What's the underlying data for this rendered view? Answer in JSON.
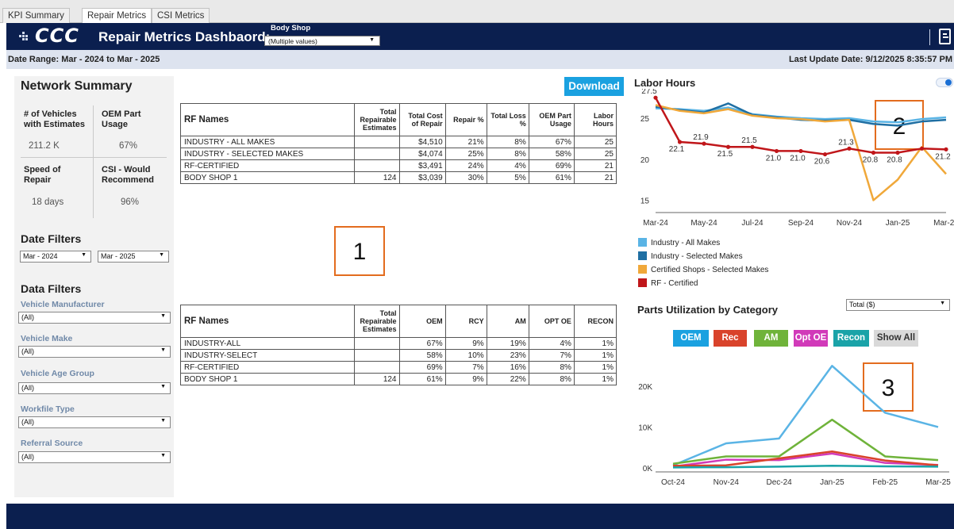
{
  "tabs": [
    "KPI Summary",
    "Repair Metrics",
    "CSI Metrics"
  ],
  "header": {
    "logo": "CCC",
    "title": "Repair Metrics Dashbaord:",
    "shop_label": "Body Shop",
    "shop_value": "(Multiple values)"
  },
  "date_bar": {
    "range": "Date Range: Mar - 2024 to Mar - 2025",
    "update": "Last Update Date: 9/12/2025 8:35:57 PM"
  },
  "network_summary": {
    "title": "Network Summary",
    "kpis": [
      {
        "label_1": "# of Vehicles",
        "label_2": "with Estimates",
        "value": "211.2 K"
      },
      {
        "label_1": "OEM Part",
        "label_2": "Usage",
        "value": "67%"
      },
      {
        "label_1": "Speed of",
        "label_2": "Repair",
        "value": "18 days"
      },
      {
        "label_1": "CSI - Would",
        "label_2": "Recommend",
        "value": "96%"
      }
    ]
  },
  "date_filters": {
    "title": "Date Filters",
    "from": "Mar - 2024",
    "to": "Mar - 2025"
  },
  "data_filters": {
    "title": "Data Filters",
    "items": [
      {
        "label": "Vehicle Manufacturer",
        "value": "(All)"
      },
      {
        "label": "Vehicle Make",
        "value": "(All)"
      },
      {
        "label": "Vehicle Age Group",
        "value": "(All)"
      },
      {
        "label": "Workfile Type",
        "value": "(All)"
      },
      {
        "label": "Referral Source",
        "value": "(All)"
      }
    ]
  },
  "download_label": "Download",
  "table1": {
    "headers": [
      "RF Names",
      "Total Repairable Estimates",
      "Total Cost of Repair",
      "Repair %",
      "Total Loss %",
      "OEM Part Usage",
      "Labor Hours"
    ],
    "rows": [
      [
        "INDUSTRY - ALL MAKES",
        "",
        "$4,510",
        "21%",
        "8%",
        "67%",
        "25"
      ],
      [
        "INDUSTRY - SELECTED MAKES",
        "",
        "$4,074",
        "25%",
        "8%",
        "58%",
        "25"
      ],
      [
        "RF-CERTIFIED",
        "",
        "$3,491",
        "24%",
        "4%",
        "69%",
        "21"
      ],
      [
        "BODY SHOP 1",
        "124",
        "$3,039",
        "30%",
        "5%",
        "61%",
        "21"
      ]
    ]
  },
  "table2": {
    "headers": [
      "RF Names",
      "Total Repairable Estimates",
      "OEM",
      "RCY",
      "AM",
      "OPT OE",
      "RECON"
    ],
    "rows": [
      [
        "INDUSTRY-ALL",
        "",
        "67%",
        "9%",
        "19%",
        "4%",
        "1%"
      ],
      [
        "INDUSTRY-SELECT",
        "",
        "58%",
        "10%",
        "23%",
        "7%",
        "1%"
      ],
      [
        "RF-CERTIFIED",
        "",
        "69%",
        "7%",
        "16%",
        "8%",
        "1%"
      ],
      [
        "BODY SHOP 1",
        "124",
        "61%",
        "9%",
        "22%",
        "8%",
        "1%"
      ]
    ]
  },
  "annotations": [
    "1",
    "2",
    "3"
  ],
  "labor_chart_title": "Labor Hours",
  "parts_chart_title": "Parts Utilization by Category",
  "parts_select": "Total ($)",
  "parts_buttons": [
    {
      "label": "OEM",
      "color": "#1aa1e0"
    },
    {
      "label": "Rec",
      "color": "#d9432b"
    },
    {
      "label": "AM",
      "color": "#6fb33a"
    },
    {
      "label": "Opt OE",
      "color": "#d13ab9"
    },
    {
      "label": "Recon",
      "color": "#1aa3a8"
    },
    {
      "label": "Show All",
      "color": "#d9d9d9"
    }
  ],
  "chart_data": [
    {
      "type": "line",
      "title": "Labor Hours",
      "x": [
        "Mar-24",
        "Apr-24",
        "May-24",
        "Jun-24",
        "Jul-24",
        "Aug-24",
        "Sep-24",
        "Oct-24",
        "Nov-24",
        "Dec-24",
        "Jan-25",
        "Feb-25",
        "Mar-25"
      ],
      "x_ticks": [
        "Mar-24",
        "May-24",
        "Jul-24",
        "Sep-24",
        "Nov-24",
        "Jan-25",
        "Mar-25"
      ],
      "y_ticks": [
        15,
        20,
        25
      ],
      "ylim": [
        13.5,
        28
      ],
      "series": [
        {
          "name": "Industry - All Makes",
          "color": "#5ab4e5",
          "values": [
            26.2,
            26.1,
            25.9,
            26.3,
            25.5,
            25.2,
            25.0,
            24.9,
            25.0,
            24.6,
            24.5,
            24.9,
            25.1
          ]
        },
        {
          "name": "Industry - Selected Makes",
          "color": "#1f6fa3",
          "values": [
            26.4,
            26.0,
            25.7,
            26.8,
            25.4,
            25.1,
            24.8,
            24.7,
            24.8,
            24.3,
            24.1,
            24.6,
            24.8
          ]
        },
        {
          "name": "Certified Shops - Selected Makes",
          "color": "#f0a83a",
          "values": [
            26.6,
            25.9,
            25.6,
            26.1,
            25.3,
            25.0,
            24.9,
            24.6,
            24.8,
            15.0,
            17.5,
            21.5,
            18.2
          ]
        },
        {
          "name": "RF - Certified",
          "color": "#c0161a",
          "values": [
            27.5,
            22.1,
            21.9,
            21.5,
            21.5,
            21.0,
            21.0,
            20.6,
            21.3,
            20.8,
            20.8,
            21.3,
            21.2
          ]
        }
      ],
      "data_labels": [
        {
          "series": "RF - Certified",
          "index": 0,
          "text": "27.5"
        },
        {
          "series": "RF - Certified",
          "index": 1,
          "text": "22.1"
        },
        {
          "series": "RF - Certified",
          "index": 2,
          "text": "21.9"
        },
        {
          "series": "RF - Certified",
          "index": 3,
          "text": "21.5"
        },
        {
          "series": "RF - Certified",
          "index": 4,
          "text": "21.5"
        },
        {
          "series": "RF - Certified",
          "index": 5,
          "text": "21.0"
        },
        {
          "series": "RF - Certified",
          "index": 6,
          "text": "21.0"
        },
        {
          "series": "RF - Certified",
          "index": 7,
          "text": "20.6"
        },
        {
          "series": "RF - Certified",
          "index": 8,
          "text": "21.3"
        },
        {
          "series": "RF - Certified",
          "index": 9,
          "text": "20.8"
        },
        {
          "series": "RF - Certified",
          "index": 10,
          "text": "20.8"
        },
        {
          "series": "RF - Certified",
          "index": 12,
          "text": "21.2"
        }
      ],
      "legend": "bottom"
    },
    {
      "type": "line",
      "title": "Parts Utilization by Category",
      "x": [
        "Oct-24",
        "Nov-24",
        "Dec-24",
        "Jan-25",
        "Feb-25",
        "Mar-25"
      ],
      "y_ticks": [
        0,
        10000,
        20000
      ],
      "y_tick_labels": [
        "0K",
        "10K",
        "20K"
      ],
      "ylim": [
        -1000,
        27000
      ],
      "series": [
        {
          "name": "OEM",
          "color": "#5ab4e5",
          "values": [
            600,
            6000,
            7200,
            25000,
            13500,
            10000
          ]
        },
        {
          "name": "AM",
          "color": "#6fb33a",
          "values": [
            1000,
            2800,
            2800,
            11800,
            2800,
            1900
          ]
        },
        {
          "name": "Opt OE",
          "color": "#d13ab9",
          "values": [
            300,
            2000,
            1900,
            3500,
            1200,
            700
          ]
        },
        {
          "name": "Rec",
          "color": "#d9432b",
          "values": [
            500,
            600,
            2300,
            4000,
            1800,
            600
          ]
        },
        {
          "name": "Recon",
          "color": "#1aa3a8",
          "values": [
            100,
            150,
            300,
            500,
            350,
            300
          ]
        }
      ]
    }
  ]
}
